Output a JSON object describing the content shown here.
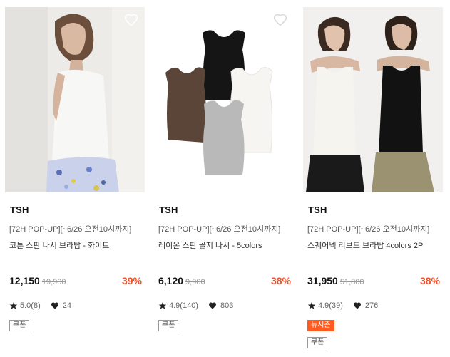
{
  "products": [
    {
      "brand": "TSH",
      "promo": "[72H POP-UP][~6/26 오전10시까지]",
      "name": "코튼 스판 나시 브라탑 - 화이트",
      "price": "12,150",
      "original_price": "19,900",
      "discount": "39%",
      "rating": "5.0(8)",
      "likes": "24",
      "badges": [
        "쿠폰"
      ]
    },
    {
      "brand": "TSH",
      "promo": "[72H POP-UP][~6/26 오전10시까지]",
      "name": "레이온 스판 골지 나시 - 5colors",
      "price": "6,120",
      "original_price": "9,900",
      "discount": "38%",
      "rating": "4.9(140)",
      "likes": "803",
      "badges": [
        "쿠폰"
      ]
    },
    {
      "brand": "TSH",
      "promo": "[72H POP-UP][~6/26 오전10시까지]",
      "name": "스퀘어넥 리브드 브라탑 4colors 2P",
      "price": "31,950",
      "original_price": "51,800",
      "discount": "38%",
      "rating": "4.9(39)",
      "likes": "276",
      "badges": [
        "뉴시즌",
        "쿠폰"
      ]
    }
  ],
  "colors": {
    "discount": "#f0522b",
    "new_badge": "#ff5a1f"
  }
}
